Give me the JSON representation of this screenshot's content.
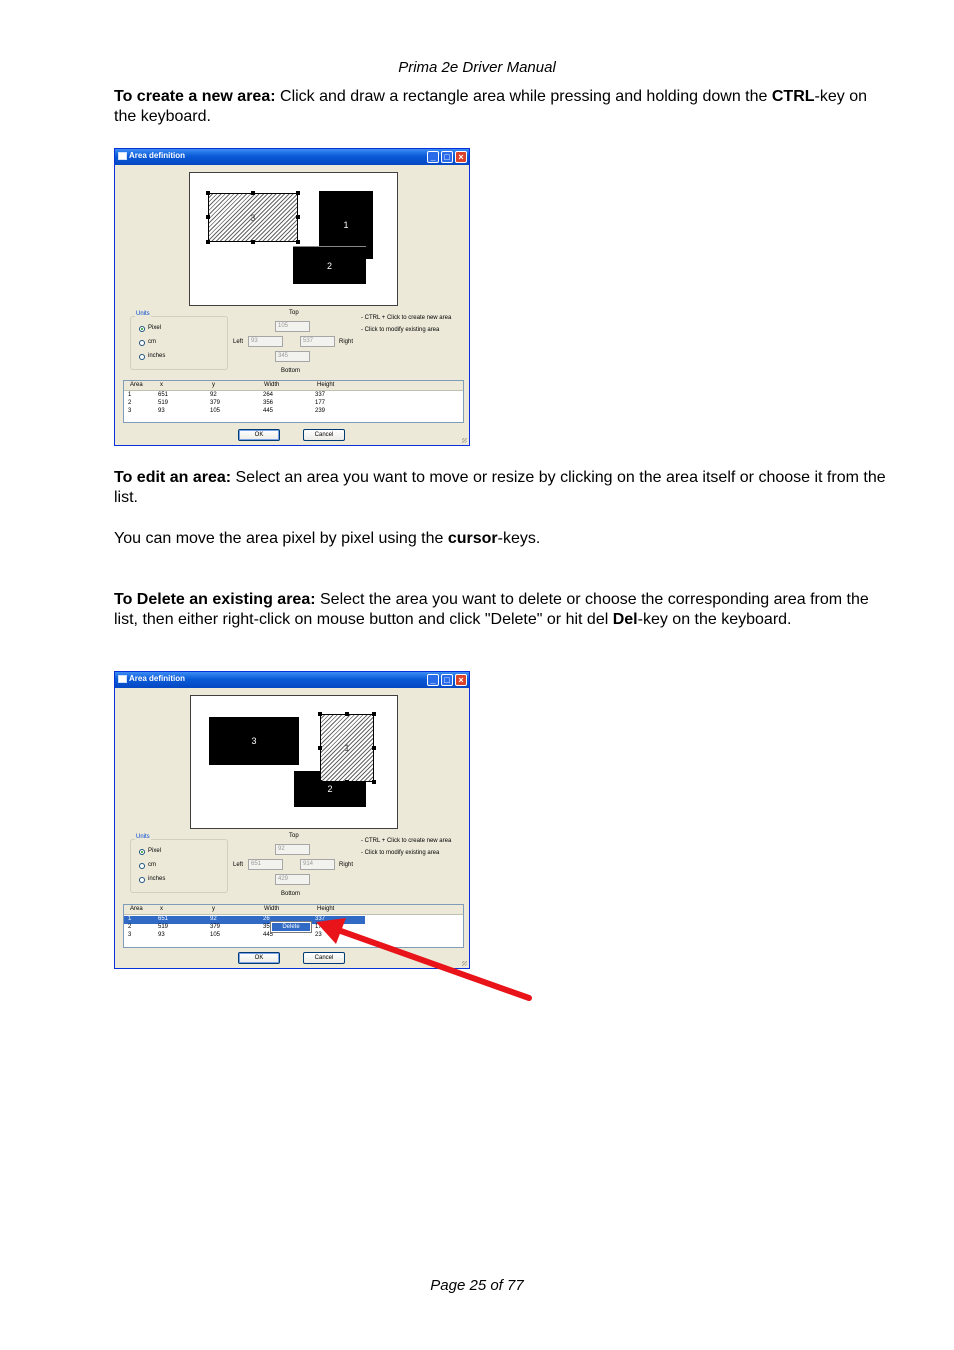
{
  "header": {
    "title": "Prima 2e Driver Manual"
  },
  "footer": {
    "page": "Page 25 of 77"
  },
  "text": {
    "p1_bold": "To create a new area:",
    "p1_a": " Click and draw a rectangle area while pressing and holding down the ",
    "p1_key": "CTRL",
    "p1_b": "-key on the keyboard.",
    "p2_bold": "To edit an area:",
    "p2_a": " Select an area you want to move or resize by clicking on the area itself or choose it from the list.",
    "p3_a": "You can move the area pixel by pixel using the ",
    "p3_key": "cursor",
    "p3_b": "-keys.",
    "p4_bold": "To Delete an existing area:",
    "p4_a": " Select the area you want to delete or choose the corresponding area from the list, then either right-click on mouse button and click \"Delete\" or hit del ",
    "p4_key": "Del",
    "p4_b": "-key on the keyboard."
  },
  "dialog1": {
    "title": "Area definition",
    "minimize": "_",
    "maximize": "□",
    "close": "×",
    "areas": [
      "1",
      "2",
      "3"
    ],
    "units": {
      "legend": "Units",
      "pixel": "Pixel",
      "cm": "cm",
      "inches": "inches",
      "selected": "pixel"
    },
    "labels": {
      "top": "Top",
      "left": "Left",
      "right": "Right",
      "bottom": "Bottom"
    },
    "fields": {
      "top": "105",
      "left": "93",
      "right": "537",
      "bottom": "345"
    },
    "hints": [
      "- CTRL + Click to create new area",
      "- Click to modify existing area"
    ],
    "columns": [
      "Area",
      "x",
      "y",
      "Width",
      "Height"
    ],
    "rows": [
      [
        "1",
        "651",
        "92",
        "264",
        "337"
      ],
      [
        "2",
        "519",
        "379",
        "356",
        "177"
      ],
      [
        "3",
        "93",
        "105",
        "445",
        "239"
      ]
    ],
    "ok": "OK",
    "cancel": "Cancel"
  },
  "dialog2": {
    "title": "Area definition",
    "minimize": "_",
    "maximize": "□",
    "close": "×",
    "areas": [
      "1",
      "2",
      "3"
    ],
    "units": {
      "legend": "Units",
      "pixel": "Pixel",
      "cm": "cm",
      "inches": "inches",
      "selected": "pixel"
    },
    "labels": {
      "top": "Top",
      "left": "Left",
      "right": "Right",
      "bottom": "Bottom"
    },
    "fields": {
      "top": "92",
      "left": "651",
      "right": "914",
      "bottom": "429"
    },
    "hints": [
      "- CTRL + Click to create new area",
      "- Click to modify existing area"
    ],
    "columns": [
      "Area",
      "x",
      "y",
      "Width",
      "Height"
    ],
    "rows": [
      [
        "1",
        "651",
        "92",
        "26",
        "337"
      ],
      [
        "2",
        "519",
        "379",
        "35",
        "177"
      ],
      [
        "3",
        "93",
        "105",
        "445",
        "23"
      ]
    ],
    "context_menu": "Delete",
    "ok": "OK",
    "cancel": "Cancel",
    "arrow_color": "#e8141a"
  }
}
